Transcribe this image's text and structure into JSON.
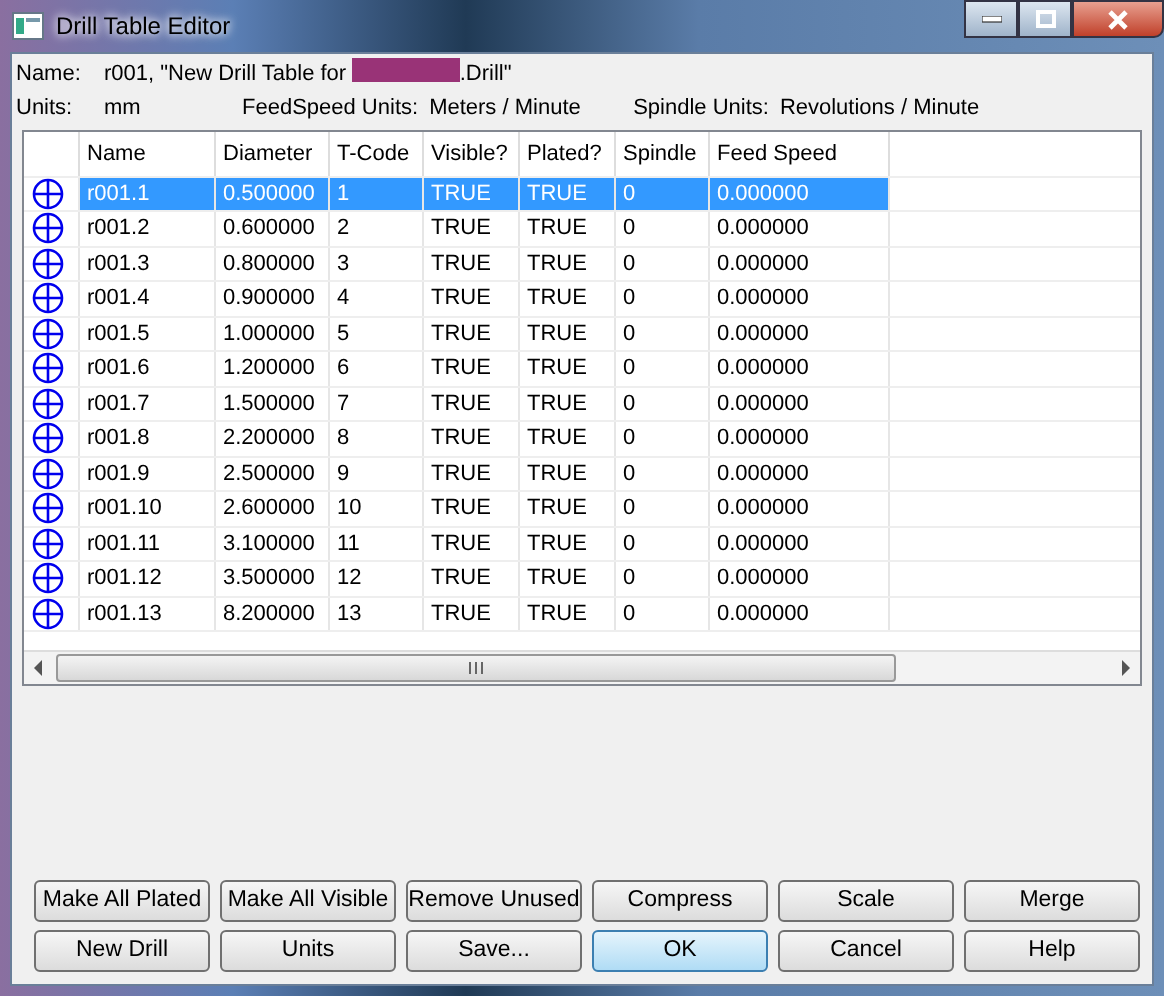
{
  "window": {
    "title": "Drill Table Editor"
  },
  "info": {
    "name_label": "Name:",
    "name_before": "r001, \"New Drill Table for",
    "name_after": ".Drill\"",
    "units_label": "Units:",
    "units": "mm",
    "feed_label": "FeedSpeed Units:",
    "feed": "Meters / Minute",
    "spindle_label": "Spindle Units:",
    "spindle": "Revolutions / Minute"
  },
  "table": {
    "columns": [
      "Name",
      "Diameter",
      "T-Code",
      "Visible?",
      "Plated?",
      "Spindle",
      "Feed Speed"
    ],
    "rows": [
      {
        "selected": true,
        "cells": [
          "r001.1",
          "0.500000",
          "1",
          "TRUE",
          "TRUE",
          "0",
          "0.000000"
        ]
      },
      {
        "selected": false,
        "cells": [
          "r001.2",
          "0.600000",
          "2",
          "TRUE",
          "TRUE",
          "0",
          "0.000000"
        ]
      },
      {
        "selected": false,
        "cells": [
          "r001.3",
          "0.800000",
          "3",
          "TRUE",
          "TRUE",
          "0",
          "0.000000"
        ]
      },
      {
        "selected": false,
        "cells": [
          "r001.4",
          "0.900000",
          "4",
          "TRUE",
          "TRUE",
          "0",
          "0.000000"
        ]
      },
      {
        "selected": false,
        "cells": [
          "r001.5",
          "1.000000",
          "5",
          "TRUE",
          "TRUE",
          "0",
          "0.000000"
        ]
      },
      {
        "selected": false,
        "cells": [
          "r001.6",
          "1.200000",
          "6",
          "TRUE",
          "TRUE",
          "0",
          "0.000000"
        ]
      },
      {
        "selected": false,
        "cells": [
          "r001.7",
          "1.500000",
          "7",
          "TRUE",
          "TRUE",
          "0",
          "0.000000"
        ]
      },
      {
        "selected": false,
        "cells": [
          "r001.8",
          "2.200000",
          "8",
          "TRUE",
          "TRUE",
          "0",
          "0.000000"
        ]
      },
      {
        "selected": false,
        "cells": [
          "r001.9",
          "2.500000",
          "9",
          "TRUE",
          "TRUE",
          "0",
          "0.000000"
        ]
      },
      {
        "selected": false,
        "cells": [
          "r001.10",
          "2.600000",
          "10",
          "TRUE",
          "TRUE",
          "0",
          "0.000000"
        ]
      },
      {
        "selected": false,
        "cells": [
          "r001.11",
          "3.100000",
          "11",
          "TRUE",
          "TRUE",
          "0",
          "0.000000"
        ]
      },
      {
        "selected": false,
        "cells": [
          "r001.12",
          "3.500000",
          "12",
          "TRUE",
          "TRUE",
          "0",
          "0.000000"
        ]
      },
      {
        "selected": false,
        "cells": [
          "r001.13",
          "8.200000",
          "13",
          "TRUE",
          "TRUE",
          "0",
          "0.000000"
        ]
      }
    ]
  },
  "buttons": [
    {
      "label": "Make All Plated",
      "default": false
    },
    {
      "label": "Make All Visible",
      "default": false
    },
    {
      "label": "Remove Unused",
      "default": false
    },
    {
      "label": "Compress",
      "default": false
    },
    {
      "label": "Scale",
      "default": false
    },
    {
      "label": "Merge",
      "default": false
    },
    {
      "label": "New Drill",
      "default": false
    },
    {
      "label": "Units",
      "default": false
    },
    {
      "label": "Save...",
      "default": false
    },
    {
      "label": "OK",
      "default": true
    },
    {
      "label": "Cancel",
      "default": false
    },
    {
      "label": "Help",
      "default": false
    }
  ]
}
